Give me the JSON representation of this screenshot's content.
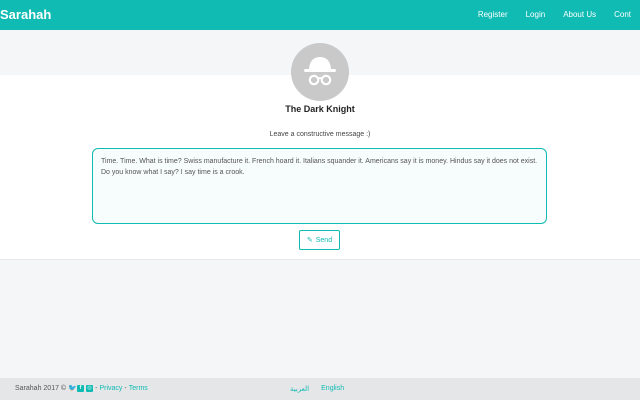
{
  "navbar": {
    "brand": "Sarahah",
    "links": [
      "Register",
      "Login",
      "About Us",
      "Cont"
    ]
  },
  "profile": {
    "name": "The Dark Knight",
    "avatar_icon": "incognito-hat-glasses-icon",
    "prompt": "Leave a constructive message :)"
  },
  "message": {
    "text": "Time. Time. What is time? Swiss manufacture it. French hoard it. Italians squander it. Americans say it is money. Hindus say it does not exist. Do you know what I say? I say time is a crook."
  },
  "send": {
    "label": "Send",
    "icon": "pencil-icon"
  },
  "footer": {
    "copyright": "Sarahah 2017 ©",
    "separator1": "-",
    "privacy": "Privacy",
    "separator2": "-",
    "terms": "Terms",
    "lang_ar": "العربية",
    "lang_en": "English"
  },
  "colors": {
    "accent": "#10bbb3",
    "background": "#f5f6f8",
    "avatar": "#c9c9c9"
  }
}
